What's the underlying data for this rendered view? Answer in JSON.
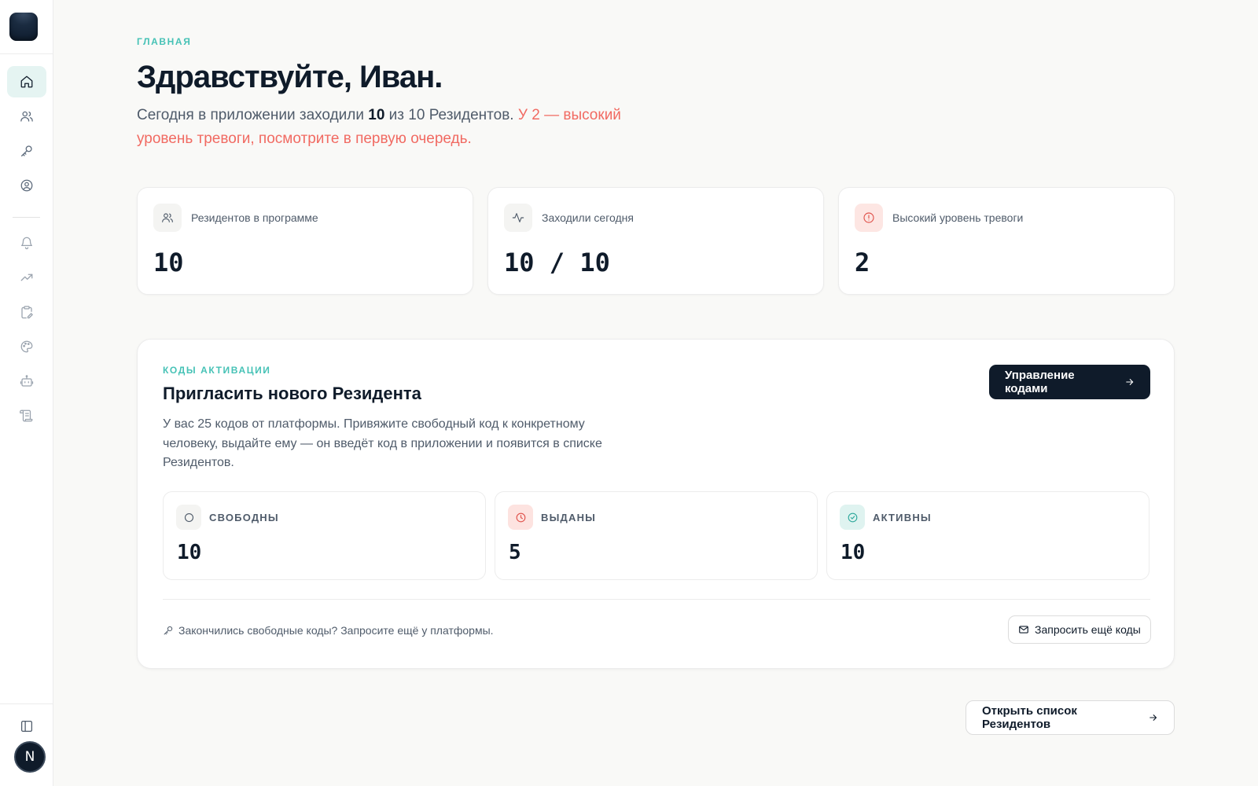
{
  "sidebar": {
    "nav": [
      {
        "icon": "home-icon",
        "active": true
      },
      {
        "icon": "users-icon"
      },
      {
        "icon": "key-icon"
      },
      {
        "icon": "user-circle-icon"
      },
      {
        "icon": "bell-icon"
      },
      {
        "icon": "trending-up-icon"
      },
      {
        "icon": "clipboard-edit-icon"
      },
      {
        "icon": "palette-icon"
      },
      {
        "icon": "bot-icon"
      },
      {
        "icon": "scroll-icon"
      }
    ],
    "panel_toggle_icon": "sidebar-toggle-icon",
    "avatar_letter": "N"
  },
  "header": {
    "eyebrow": "ГЛАВНАЯ",
    "title": "Здравствуйте, Иван.",
    "subtitle_pre": "Сегодня в приложении заходили ",
    "subtitle_count": "10",
    "subtitle_mid": " из 10 Резидентов. ",
    "subtitle_alert": "У 2 — высокий уровень тревоги, посмотрите в первую очередь."
  },
  "stats": [
    {
      "icon": "users-icon",
      "label": "Резидентов в программе",
      "value": "10"
    },
    {
      "icon": "activity-icon",
      "label": "Заходили сегодня",
      "value": "10 / 10"
    },
    {
      "icon": "alert-circle-icon",
      "label": "Высокий уровень тревоги",
      "value": "2"
    }
  ],
  "codes": {
    "eyebrow": "КОДЫ АКТИВАЦИИ",
    "title": "Пригласить нового Резидента",
    "description": "У вас 25 кодов от платформы. Привяжите свободный код к конкретному человеку, выдайте ему — он введёт код в приложении и появится в списке Резидентов.",
    "manage_button": "Управление кодами",
    "cards": [
      {
        "icon": "circle-icon",
        "label": "СВОБОДНЫ",
        "value": "10"
      },
      {
        "icon": "clock-icon",
        "label": "ВЫДАНЫ",
        "value": "5"
      },
      {
        "icon": "check-circle-icon",
        "label": "АКТИВНЫ",
        "value": "10"
      }
    ],
    "footer_note": "Закончились свободные коды? Запросите ещё у платформы.",
    "request_button": "Запросить ещё коды"
  },
  "open_list_button": "Открыть список Резидентов",
  "colors": {
    "accent_teal": "#46c2b6",
    "alert_red": "#f16a62",
    "dark": "#0f1b2a",
    "background": "#f9f9f7"
  }
}
